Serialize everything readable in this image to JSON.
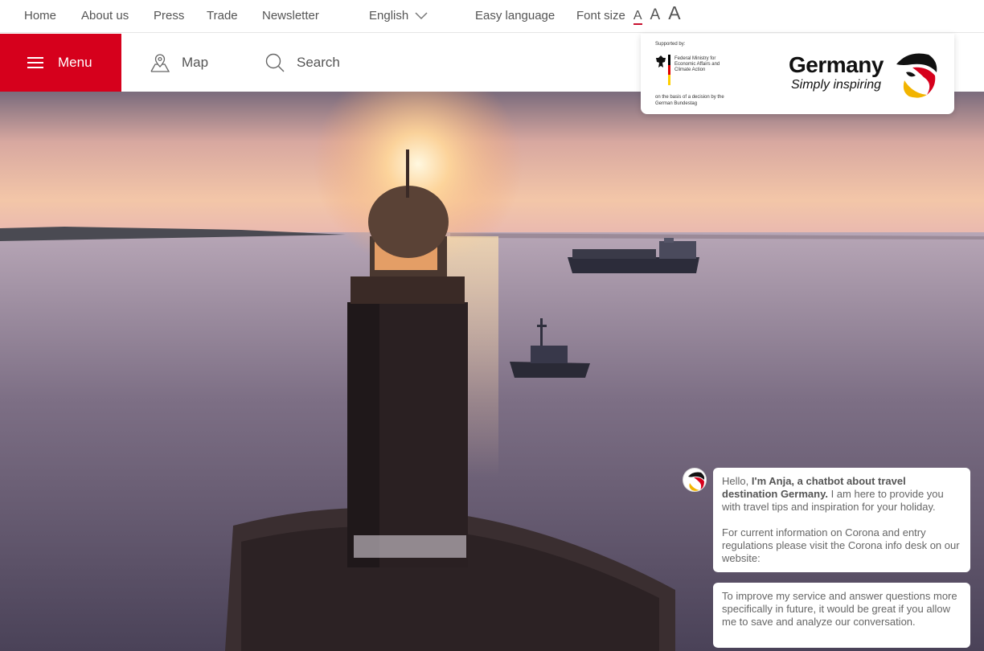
{
  "topbar": {
    "links": [
      "Home",
      "About us",
      "Press",
      "Trade",
      "Newsletter"
    ],
    "language": "English",
    "easy_language": "Easy language",
    "font_size_label": "Font size",
    "font_size_options": [
      "A",
      "A",
      "A"
    ]
  },
  "nav": {
    "menu_label": "Menu",
    "map_label": "Map",
    "search_label": "Search"
  },
  "logo": {
    "supported_by": "Supported by:",
    "ministry": "Federal Ministry for Economic Affairs and Climate Action",
    "basis": "on the basis of a decision by the German Bundestag",
    "brand_title": "Germany",
    "brand_subtitle": "Simply inspiring"
  },
  "chat": {
    "greeting_prefix": "Hello, ",
    "greeting_bold": "I'm Anja, a chatbot about travel destination Germany.",
    "greeting_rest": " I am here to provide you with travel tips and inspiration for your holiday.",
    "corona_text": "For current information on Corona and entry regulations please visit the Corona info desk on our website:",
    "consent_text": "To improve my service and answer questions more specifically in future, it would be great if you allow me to save and analyze our conversation."
  },
  "colors": {
    "accent": "#d6001c",
    "font_size_underline": "#c8102e"
  },
  "icons": {
    "menu": "hamburger-icon",
    "map": "map-pin-icon",
    "search": "search-icon",
    "language": "chevron-down-icon"
  }
}
